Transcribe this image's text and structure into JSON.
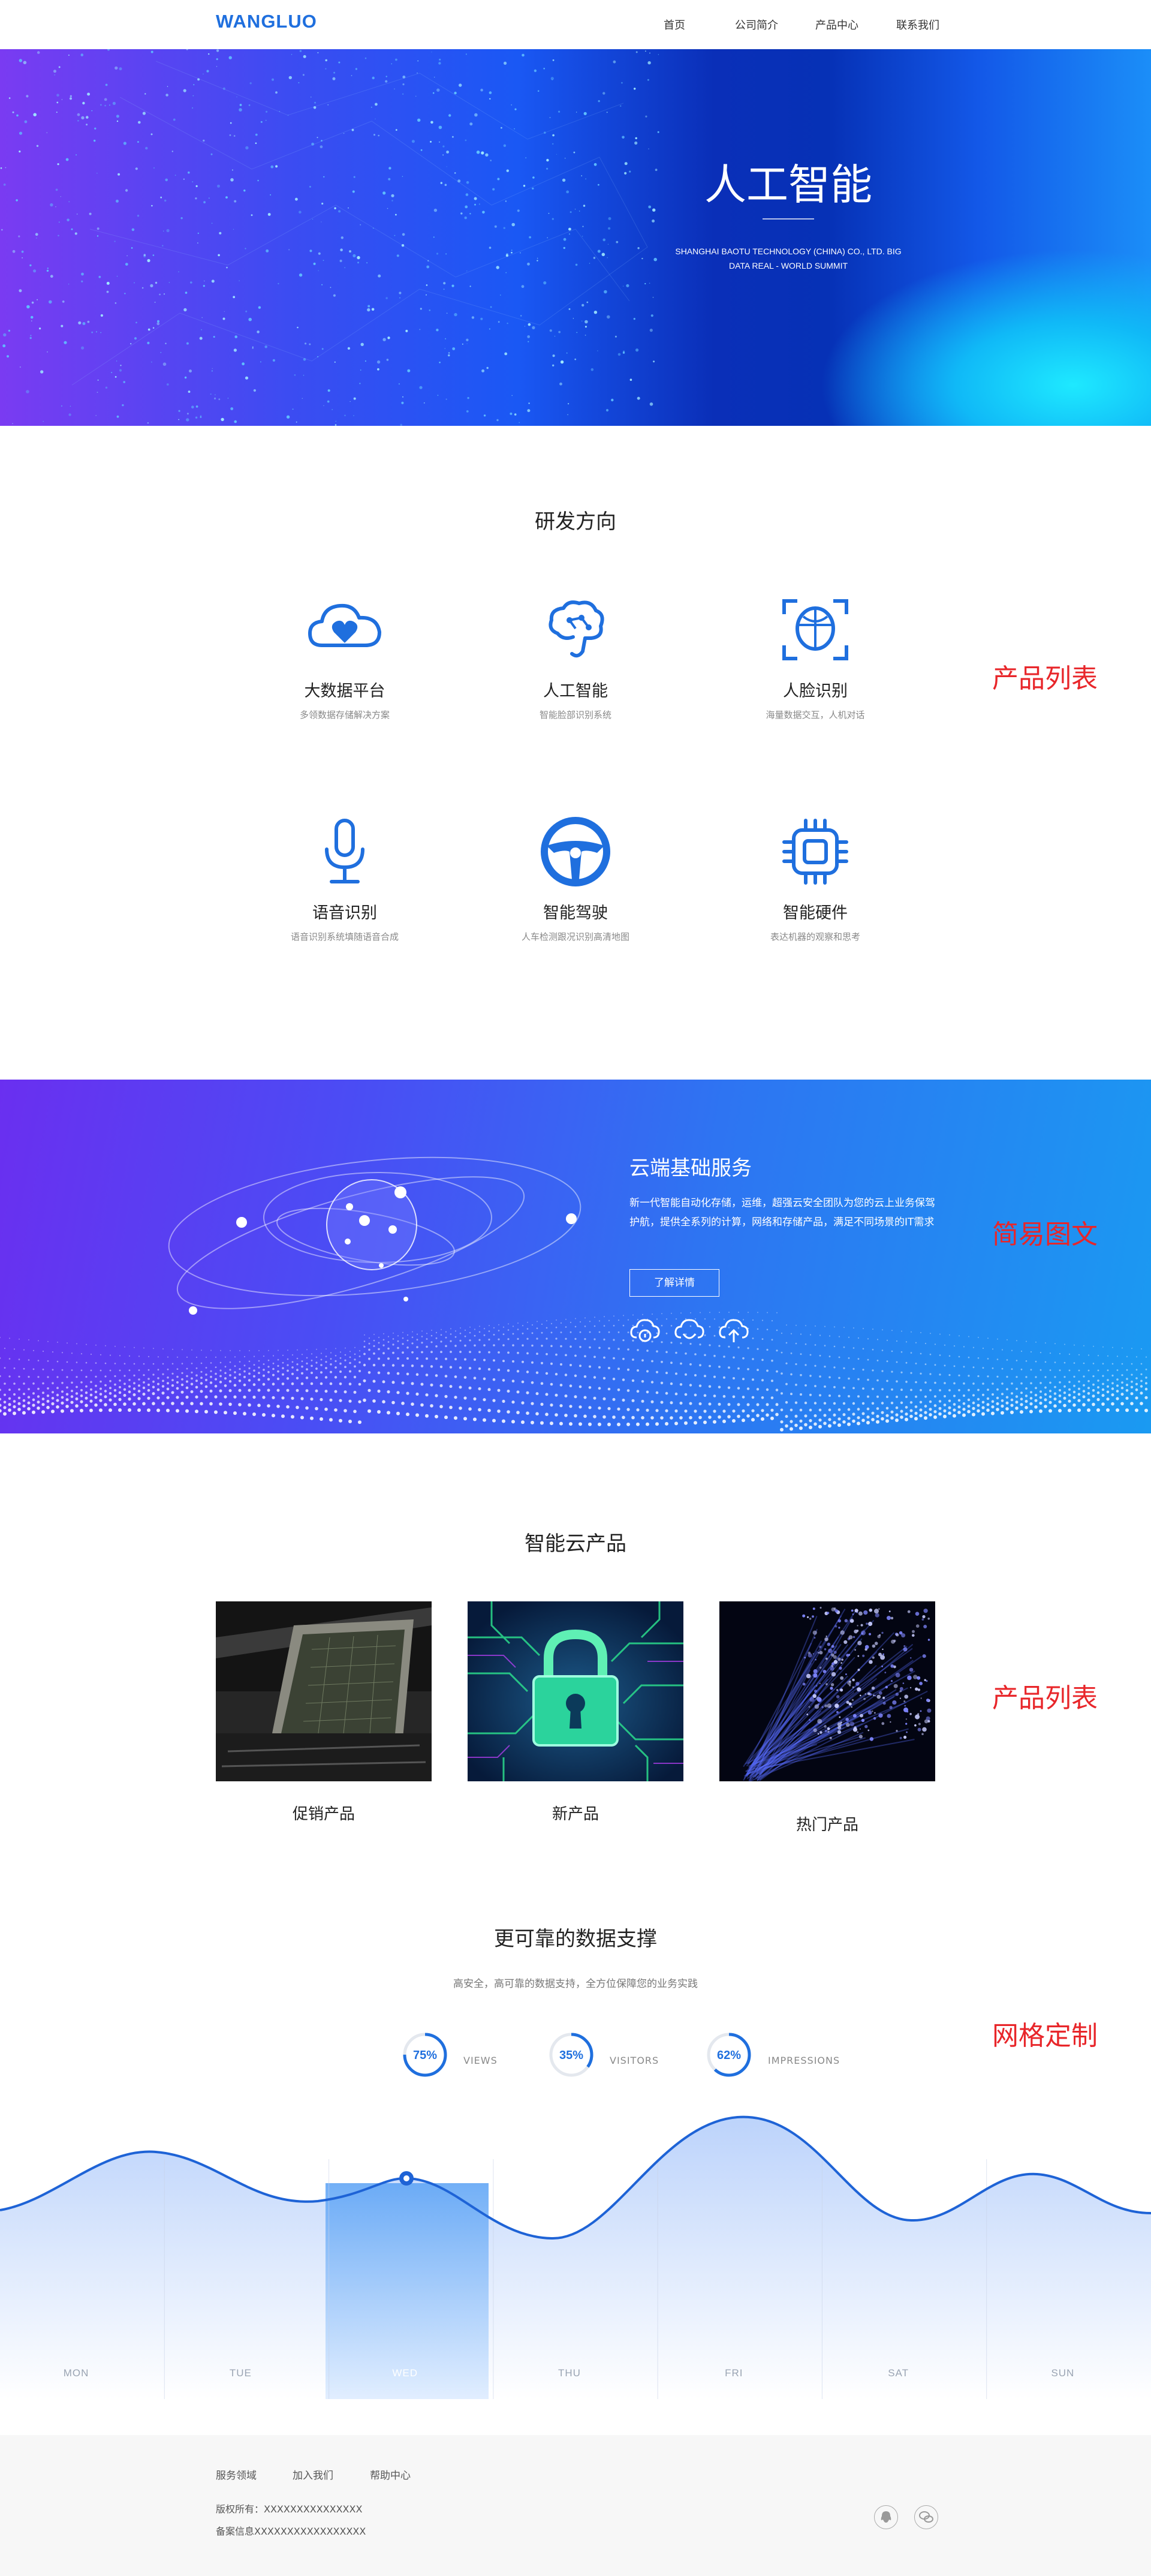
{
  "header": {
    "logo": "WANGLUO",
    "nav": [
      "首页",
      "公司简介",
      "产品中心",
      "联系我们"
    ]
  },
  "hero": {
    "title": "人工智能",
    "subtitle_line1": "SHANGHAI BAOTU TECHNOLOGY (CHINA) CO., LTD. BIG",
    "subtitle_line2": "DATA REAL - WORLD SUMMIT"
  },
  "research": {
    "title": "研发方向",
    "note": "产品列表",
    "items": [
      {
        "title": "大数据平台",
        "desc": "多领数据存储解决方案",
        "icon": "cloud-heart-icon"
      },
      {
        "title": "人工智能",
        "desc": "智能脸部识别系统",
        "icon": "brain-icon"
      },
      {
        "title": "人脸识别",
        "desc": "海量数据交互，人机对话",
        "icon": "face-scan-icon"
      },
      {
        "title": "语音识别",
        "desc": "语音识别系统填随语音合成",
        "icon": "microphone-icon"
      },
      {
        "title": "智能驾驶",
        "desc": "人车检测跟况识别高清地图",
        "icon": "steering-wheel-icon"
      },
      {
        "title": "智能硬件",
        "desc": "表达机器的观察和思考",
        "icon": "chip-icon"
      }
    ]
  },
  "cloud": {
    "title": "云端基础服务",
    "text": "新一代智能自动化存储，运维，超强云安全团队为您的云上业务保驾护航，提供全系列的计算，网络和存储产品，满足不同场景的IT需求",
    "button": "了解详情",
    "note": "简易图文"
  },
  "products": {
    "title": "智能云产品",
    "note": "产品列表",
    "items": [
      {
        "label": "促销产品",
        "image": "chip-photo"
      },
      {
        "label": "新产品",
        "image": "lock-circuit-photo"
      },
      {
        "label": "热门产品",
        "image": "fiber-optic-photo"
      }
    ]
  },
  "stats": {
    "title": "更可靠的数据支撑",
    "subtitle": "高安全，高可靠的数据支持，全方位保障您的业务实践",
    "note": "网格定制",
    "items": [
      {
        "value": "75%",
        "label": "VIEWS",
        "fraction": 0.75
      },
      {
        "value": "35%",
        "label": "VISITORS",
        "fraction": 0.35
      },
      {
        "value": "62%",
        "label": "IMPRESSIONS",
        "fraction": 0.62
      }
    ],
    "days": [
      "MON",
      "TUE",
      "WED",
      "THU",
      "FRI",
      "SAT",
      "SUN"
    ],
    "active_day": "WED"
  },
  "footer": {
    "links": [
      "服务领域",
      "加入我们",
      "帮助中心"
    ],
    "copyright": "版权所有：XXXXXXXXXXXXXXX",
    "icp": "备案信息XXXXXXXXXXXXXXXXX",
    "social_icons": [
      "qq-icon",
      "wechat-icon"
    ]
  },
  "colors": {
    "accent": "#1f6fde",
    "note_red": "#e8262a"
  }
}
